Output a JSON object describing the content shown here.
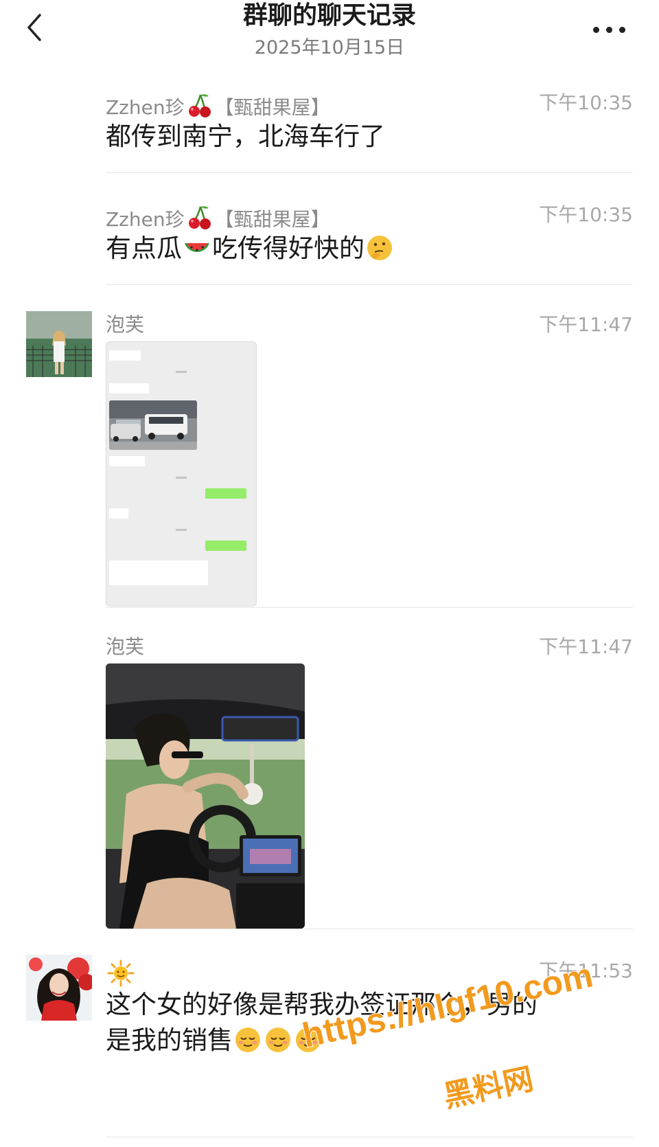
{
  "header": {
    "title": "群聊的聊天记录",
    "date": "2025年10月15日"
  },
  "messages": [
    {
      "sender": "Zzhen珍",
      "sender_suffix": "【甄甜果屋】",
      "time": "下午10:35",
      "text": "都传到南宁，北海车行了"
    },
    {
      "sender": "Zzhen珍",
      "sender_suffix": "【甄甜果屋】",
      "time": "下午10:35",
      "text_a": "有点瓜",
      "text_b": "吃传得好快的"
    },
    {
      "sender": "泡芙",
      "time": "下午11:47"
    },
    {
      "sender": "泡芙",
      "time": "下午11:47"
    },
    {
      "sender": "",
      "time": "下午11:53",
      "line1": "这个女的好像是帮我办签证那个，男的",
      "line2": "是我的销售"
    }
  ],
  "watermark": {
    "url": "https://hlgf10.com",
    "brand": "黑料网"
  },
  "colors": {
    "background": "#ffffff",
    "bubble_green": "#95ec69",
    "watermark_orange": "#f29a1e"
  }
}
